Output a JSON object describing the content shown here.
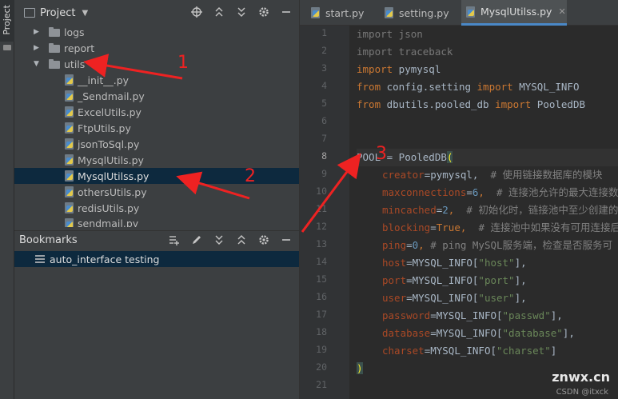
{
  "stripe": {
    "label": "Project"
  },
  "project_panel": {
    "title": "Project",
    "tree": [
      {
        "label": "logs",
        "type": "folder",
        "expanded": false
      },
      {
        "label": "report",
        "type": "folder",
        "expanded": false
      },
      {
        "label": "utils",
        "type": "folder",
        "expanded": true
      },
      {
        "label": "__init__.py",
        "type": "py"
      },
      {
        "label": "_Sendmail.py",
        "type": "py"
      },
      {
        "label": "ExcelUtils.py",
        "type": "py"
      },
      {
        "label": "FtpUtils.py",
        "type": "py"
      },
      {
        "label": "jsonToSql.py",
        "type": "py"
      },
      {
        "label": "MysqlUtils.py",
        "type": "py"
      },
      {
        "label": "MysqlUtilss.py",
        "type": "py",
        "selected": true
      },
      {
        "label": "othersUtils.py",
        "type": "py"
      },
      {
        "label": "redisUtils.py",
        "type": "py"
      },
      {
        "label": "sendmail.py",
        "type": "py"
      }
    ]
  },
  "bookmarks": {
    "title": "Bookmarks",
    "items": [
      {
        "label": "auto_interface testing"
      }
    ]
  },
  "editor": {
    "tabs": [
      {
        "label": "start.py",
        "active": false
      },
      {
        "label": "setting.py",
        "active": false
      },
      {
        "label": "MysqlUtilss.py",
        "active": true
      }
    ],
    "line_numbers": [
      "1",
      "2",
      "3",
      "4",
      "5",
      "6",
      "7",
      "8",
      "9",
      "10",
      "11",
      "12",
      "13",
      "14",
      "15",
      "16",
      "17",
      "18",
      "19",
      "20",
      "21"
    ],
    "current_line": "8",
    "code": {
      "l1_kw": "import",
      "l1_rest": " json",
      "l2_kw": "import",
      "l2_rest": " traceback",
      "l3_kw": "import",
      "l3_rest": " pymysql",
      "l4_kw1": "from",
      "l4_mid": " config.setting ",
      "l4_kw2": "import",
      "l4_rest": " MYSQL_INFO",
      "l5_kw1": "from",
      "l5_mid": " dbutils.pooled_db ",
      "l5_kw2": "import",
      "l5_rest": " PooledDB",
      "l8_a": "POOL = PooledDB",
      "l8_paren": "(",
      "l9_p": "creator",
      "l9_v": "=pymysql,",
      "l9_c": "  # 使用链接数据库的模块",
      "l10_p": "maxconnections",
      "l10_eq": "=",
      "l10_n": "6",
      "l10_comma": ",",
      "l10_c": "  # 连接池允许的最大连接数",
      "l11_p": "mincached",
      "l11_eq": "=",
      "l11_n": "2",
      "l11_comma": ",",
      "l11_c": "  # 初始化时，链接池中至少创建的",
      "l12_p": "blocking",
      "l12_eq": "=",
      "l12_k": "True",
      "l12_comma": ",",
      "l12_c": "  # 连接池中如果没有可用连接后",
      "l13_p": "ping",
      "l13_eq": "=",
      "l13_n": "0",
      "l13_comma": ",",
      "l13_c": " # ping MySQL服务端，检查是否服务可",
      "l14_p": "host",
      "l14_a": "=MYSQL_INFO[",
      "l14_s": "\"host\"",
      "l14_b": "],",
      "l15_p": "port",
      "l15_a": "=MYSQL_INFO[",
      "l15_s": "\"port\"",
      "l15_b": "],",
      "l16_p": "user",
      "l16_a": "=MYSQL_INFO[",
      "l16_s": "\"user\"",
      "l16_b": "],",
      "l17_p": "password",
      "l17_a": "=MYSQL_INFO[",
      "l17_s": "\"passwd\"",
      "l17_b": "],",
      "l18_p": "database",
      "l18_a": "=MYSQL_INFO[",
      "l18_s": "\"database\"",
      "l18_b": "],",
      "l19_p": "charset",
      "l19_a": "=MYSQL_INFO[",
      "l19_s": "\"charset\"",
      "l19_b": "]",
      "l20": ")"
    }
  },
  "annotations": {
    "n1": "1",
    "n2": "2",
    "n3": "3",
    "color": "#ee2222"
  },
  "watermark": {
    "main": "znwx.cn",
    "sub": "CSDN @itxck"
  },
  "colors": {
    "selection": "#0d293e",
    "keyword": "#cc7832",
    "param": "#aa4926",
    "string": "#6a8759",
    "number": "#6897bb",
    "comment": "#808080",
    "accent": "#4a88c7"
  }
}
